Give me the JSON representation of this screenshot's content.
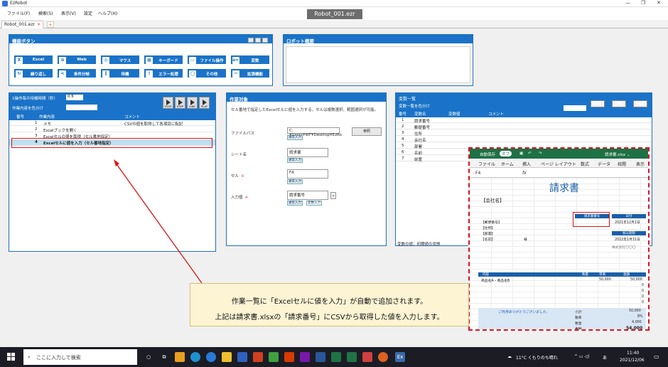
{
  "window": {
    "app_name": "EzRobot",
    "doc_title": "Robot_001.ezr",
    "controls": [
      "—",
      "❐",
      "✕"
    ]
  },
  "menu": [
    "ファイル(F)",
    "検索(S)",
    "表示(V)",
    "設定",
    "ヘルプ(H)"
  ],
  "tab": {
    "label": "Robot_001.ezr",
    "close": "×",
    "add": "+"
  },
  "functions": {
    "title": "機能ボタン",
    "buttons": [
      {
        "label": "Excel",
        "icon": "X"
      },
      {
        "label": "Web",
        "icon": "⊕"
      },
      {
        "label": "マウス",
        "icon": "◎"
      },
      {
        "label": "キーボード",
        "icon": "▦"
      },
      {
        "label": "ファイル操作",
        "icon": "▭"
      },
      {
        "label": "変数",
        "icon": "a=1"
      },
      {
        "label": "繰り返し",
        "icon": "↻"
      },
      {
        "label": "条件分岐",
        "icon": "<"
      },
      {
        "label": "待機",
        "icon": "‖"
      },
      {
        "label": "エラー処理",
        "icon": "!"
      },
      {
        "label": "その他",
        "icon": "◯"
      },
      {
        "label": "拡張機能",
        "icon": "✂"
      }
    ]
  },
  "robot_overview": {
    "title": "ロボット概要"
  },
  "task_list": {
    "wait_label": "1操作毎の待機時間（秒）",
    "wait_value": "0.5",
    "color_label": "作業内容を色分け",
    "play_buttons": [
      "STOP",
      "STEP",
      "LINE",
      "PLAY"
    ],
    "columns": [
      "番号",
      "作業内容",
      "コメント"
    ],
    "rows": [
      {
        "num": "1",
        "task": "メモ",
        "comment": "CSVの値を取得して各項目に転記"
      },
      {
        "num": "2",
        "task": "Excelブックを開く",
        "comment": ""
      },
      {
        "num": "3",
        "task": "Excelセルの値を取得（セル番地指定）",
        "comment": ""
      },
      {
        "num": "4",
        "task": "Excelセルに値を入力（セル番地指定）",
        "comment": ""
      }
    ]
  },
  "work_target": {
    "title": "作業対象",
    "description": "セル番地で指定したExcelセルに値を入力する。セルは複数選択、範囲選択が可能。",
    "file_path_label": "ファイルパス",
    "file_path_value": "C:¥Users¥WF¥Desktop¥EzRo",
    "ref_button": "参照",
    "sheet_label": "シート名",
    "sheet_value": "請求書",
    "cell_label": "セル",
    "cell_value": "F4",
    "input_label": "入力値",
    "input_value": "請求番号",
    "required_mark": "※",
    "normal_input": "通常入力",
    "var_input": "変数入力",
    "dropdown": "⌄"
  },
  "variables": {
    "title": "変数一覧",
    "color_label": "変数一覧を色分け",
    "add_button": "追加",
    "delete_button": "削除",
    "edit_button": "編集",
    "columns": [
      "番号",
      "変数名",
      "変数値",
      "コメント"
    ],
    "rows": [
      {
        "num": "1",
        "name": "請求番号"
      },
      {
        "num": "2",
        "name": "郵便番号"
      },
      {
        "num": "3",
        "name": "住所"
      },
      {
        "num": "4",
        "name": "会社名"
      },
      {
        "num": "5",
        "name": "部署"
      },
      {
        "num": "6",
        "name": "名前"
      },
      {
        "num": "7",
        "name": "前置"
      }
    ],
    "footer": "変数の値：初期値の状態"
  },
  "excel": {
    "autosave": "自動保存",
    "autosave_state": "オフ",
    "filename": "請求書.xlsx ⌄",
    "ribbon": [
      "ファイル",
      "ホーム",
      "挿入",
      "ページ レイアウト",
      "数式",
      "データ",
      "校閲",
      "表示"
    ],
    "name_box": "F4",
    "fx": "fx",
    "invoice_title": "請求書",
    "company_label": "【会社名】",
    "invoice_number_header": "請求書番号",
    "date_header": "日付",
    "date_value": "2021年12月1日",
    "zip_label": "【郵便番号】",
    "address_label": "【住所】",
    "dept_label": "【部署】",
    "name_label": "【名前】",
    "honorific": "様",
    "due_header": "振込期限",
    "due_value": "2022年1月31日",
    "seller": "株式会社〇〇〇",
    "col_item": "内容",
    "col_qty": "数量",
    "col_unit": "単価",
    "col_amount": "金額",
    "first_item": "商品名A・商品名B",
    "first_unit": "50,000",
    "first_amount": "50,000",
    "zero": "0",
    "thanks": "ご利用ありがとうございました。",
    "subtotal_label": "小計",
    "subtotal": "50,000",
    "tax_rate_label": "税率",
    "tax_rate": "8%",
    "tax_label": "税金",
    "tax": "4,000",
    "total_label": "合計",
    "total": "54,000"
  },
  "callout": {
    "line1": "作業一覧に「Excelセルに値を入力」が自動で追加されます。",
    "line2": "上記は請求書.xlsxの「請求番号」にCSVから取得した値を入力します。"
  },
  "taskbar": {
    "search_placeholder": "ここに入力して検索",
    "weather": "11°C くもりのち晴れ",
    "ime": "あ",
    "time": "11:40",
    "date": "2021/12/06"
  }
}
